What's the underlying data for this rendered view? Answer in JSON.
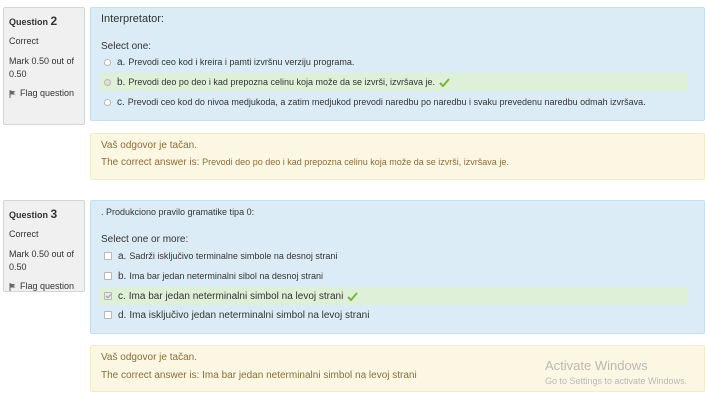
{
  "q2": {
    "info": {
      "label": "Question",
      "number": "2",
      "state": "Correct",
      "mark": "Mark 0.50 out of 0.50",
      "flag": "Flag question"
    },
    "qtext": "Interpretator:",
    "prompt": "Select one:",
    "options": [
      {
        "letter": "a.",
        "text": "Prevodi ceo kod i kreira i pamti izvršnu verziju programa.",
        "selected": false
      },
      {
        "letter": "b.",
        "text": "Prevodi deo po deo i kad prepozna celinu koja može da se izvrši, izvršava je.",
        "selected": true
      },
      {
        "letter": "c.",
        "text": "Prevodi ceo kod do nivoa medjukoda, a zatim medjukod prevodi naredbu po naredbu i svaku prevedenu naredbu odmah izvršava.",
        "selected": false
      }
    ],
    "feedback": {
      "general": "Vaš odgovor je tačan.",
      "right_label": "The correct answer is: ",
      "right_answer": "Prevodi deo po deo i kad prepozna celinu koja može da se izvrši, izvršava je."
    }
  },
  "q3": {
    "info": {
      "label": "Question",
      "number": "3",
      "state": "Correct",
      "mark": "Mark 0.50 out of 0.50",
      "flag": "Flag question"
    },
    "qtext": ". Produkciono pravilo gramatike tipa 0:",
    "prompt": "Select one or more:",
    "options": [
      {
        "letter": "a.",
        "text": "Sadrži isključivo terminalne simbole na desnoj strani",
        "selected": false
      },
      {
        "letter": "b.",
        "text": "Ima bar jedan neterminalni sibol na desnoj strani",
        "selected": false
      },
      {
        "letter": "c.",
        "text": "Ima bar jedan neterminalni simbol na levoj strani",
        "selected": true
      },
      {
        "letter": "d.",
        "text": "Ima isključivo jedan neterminalni simbol na levoj strani",
        "selected": false
      }
    ],
    "feedback": {
      "general": "Vaš odgovor je tačan.",
      "right_label": "The correct answer is: ",
      "right_answer": "Ima bar jedan neterminalni simbol na levoj strani"
    }
  },
  "watermark": {
    "title": "Activate Windows",
    "subtitle": "Go to Settings to activate Windows."
  },
  "colors": {
    "info_bg": "#f0f0f0",
    "question_bg": "#dcecf6",
    "feedback_bg": "#fcf7e2",
    "selected_bg": "#dff0d8",
    "correct_tick": "#7cb342",
    "feedback_text": "#8a6d3b"
  },
  "icons": {
    "flag": "flag-icon",
    "correct": "check-icon"
  }
}
